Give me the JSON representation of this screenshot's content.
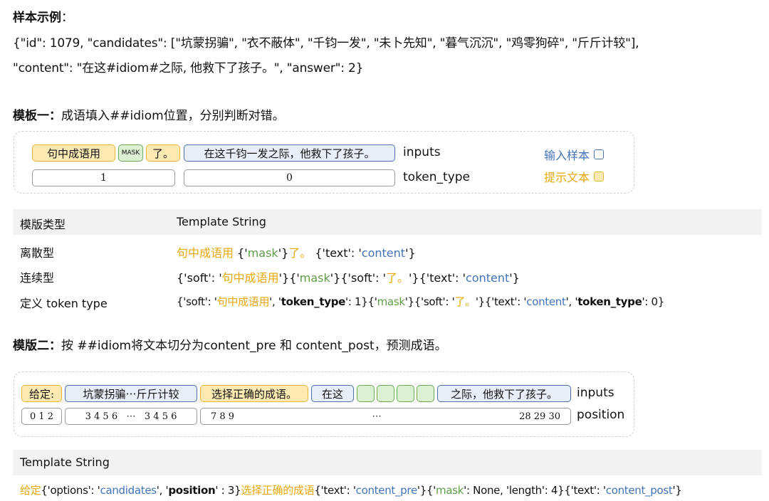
{
  "sample": {
    "title": "样本示例",
    "colon": "：",
    "line1": "{\"id\": 1079, \"candidates\": [\"坑蒙拐骗\", \"衣不蔽体\", \"千钧一发\", \"未卜先知\", \"暮气沉沉\", \"鸡零狗碎\", \"斤斤计较\"],",
    "line2": "\"content\": \"在这#idiom#之际, 他救下了孩子。\", \"answer\": 2}"
  },
  "template1": {
    "title": "模板一：",
    "desc": "成语填入##idiom位置，分别判断对错。",
    "chips": {
      "hint": "句中成语用",
      "mask": "MASK",
      "le": "了。",
      "content": "在这千钧一发之际，他救下了孩子。",
      "type1": "1",
      "type0": "0"
    },
    "row_labels": {
      "inputs": "inputs",
      "token_type": "token_type"
    },
    "legend": {
      "input": "输入样本",
      "hint": "提示文本"
    }
  },
  "table": {
    "headers": [
      "模版类型",
      "Template String"
    ],
    "rows": {
      "discrete": {
        "label": "离散型",
        "p1": "句中成语用",
        "p2": " {'",
        "p3": "mask",
        "p4": "'}",
        "p5": "了。",
        "p6": " {'text': '",
        "p7": "content",
        "p8": "'}"
      },
      "continuous": {
        "label": "连续型",
        "p1": "{'soft': '",
        "p2": "句中成语用",
        "p3": "'}{'",
        "p4": "mask",
        "p5": "'}{'soft': '",
        "p6": "了。",
        "p7": "'}{'text': '",
        "p8": "content",
        "p9": "'}"
      },
      "tokentype": {
        "label": "定义 token type",
        "p1": "{'soft': '",
        "p2": "句中成语用",
        "p3": "', '",
        "p4": "token_type",
        "p5": "': 1}{'",
        "p6": "mask",
        "p7": "'}{'soft': '",
        "p8": "了。",
        "p9": "'}{'text': '",
        "p10": "content",
        "p11": "', '",
        "p12": "token_type",
        "p13": "': 0}"
      }
    }
  },
  "template2": {
    "title": "模版二：",
    "desc": "按 ##idiom将文本切分为content_pre 和 content_post，预测成语。",
    "chips": {
      "given": "给定:",
      "cands": "坑蒙拐骗⋯斤斤计较",
      "choose": "选择正确的成语。",
      "pre": "在这",
      "post": "之际，他救下了孩子。",
      "pos1": "0 1 2",
      "pos2": "3 4 5 6   ⋯   3 4 5 6",
      "pos3a": "7 8 9",
      "pos3b": "⋯",
      "pos3c": "28 29 30"
    },
    "row_labels": {
      "inputs": "inputs",
      "position": "position"
    },
    "template_header": "Template String",
    "template": {
      "p1": "给定",
      "p2": "{'options': '",
      "p3": "candidates",
      "p4": "', '",
      "p5": "position",
      "p6": "' : 3}",
      "p7": "选择正确的成语",
      "p8": "{'text': '",
      "p9": "content_pre",
      "p10": "'}{'",
      "p11": "mask",
      "p12": "': None, 'length': 4}{'text': '",
      "p13": "content_post",
      "p14": "'}"
    }
  },
  "colors": {
    "yellow": "#e8a70c",
    "blue": "#4273b8",
    "green": "#5e9c46"
  }
}
